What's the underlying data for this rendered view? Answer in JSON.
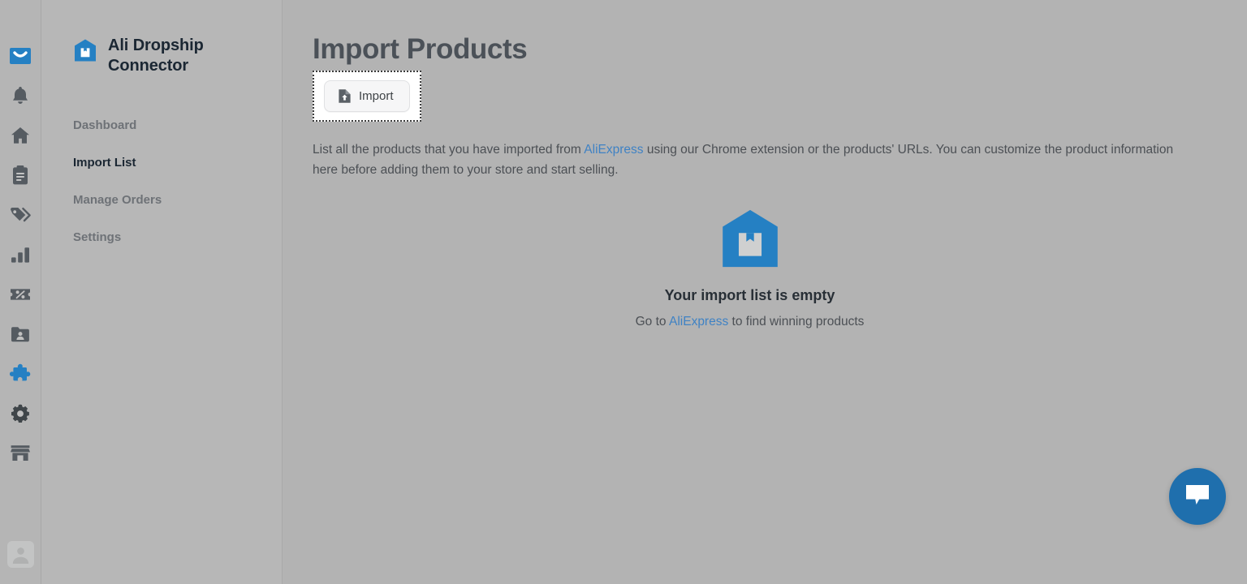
{
  "rail": {
    "items": [
      {
        "name": "mail-icon",
        "label": "Mail",
        "active": true
      },
      {
        "name": "bell-icon",
        "label": "Notifications",
        "active": false
      },
      {
        "name": "home-icon",
        "label": "Home",
        "active": false
      },
      {
        "name": "clipboard-icon",
        "label": "Orders",
        "active": false
      },
      {
        "name": "tag-icon",
        "label": "Products",
        "active": false
      },
      {
        "name": "bar-chart-icon",
        "label": "Analytics",
        "active": false
      },
      {
        "name": "discount-icon",
        "label": "Discounts",
        "active": false
      },
      {
        "name": "customers-icon",
        "label": "Customers",
        "active": false
      },
      {
        "name": "puzzle-icon",
        "label": "Apps",
        "active": true
      },
      {
        "name": "gear-icon",
        "label": "Settings",
        "active": false
      },
      {
        "name": "store-icon",
        "label": "Online Store",
        "active": false
      }
    ],
    "avatar_label": "Account"
  },
  "sidebar": {
    "brand": {
      "name": "Ali Dropship Connector",
      "line1": "Ali Dropship",
      "line2": "Connector"
    },
    "items": [
      {
        "label": "Dashboard",
        "active": false
      },
      {
        "label": "Import List",
        "active": true
      },
      {
        "label": "Manage Orders",
        "active": false
      },
      {
        "label": "Settings",
        "active": false
      }
    ]
  },
  "main": {
    "title": "Import Products",
    "import_button": {
      "label": "Import",
      "icon": "file-upload-icon"
    },
    "description": {
      "part1": "List all the products that you have imported from ",
      "link": "AliExpress",
      "part2": " using our Chrome extension or the products' URLs. You can customize the product information here before adding them to your store and start selling."
    },
    "empty_state": {
      "icon": "package-house-icon",
      "title": "Your import list is empty",
      "prefix": "Go to ",
      "link": "AliExpress",
      "suffix": " to find winning products"
    }
  },
  "chat": {
    "label": "Chat",
    "icon": "chat-bubble-icon"
  },
  "colors": {
    "brand_blue": "#2580c3",
    "chat_blue": "#1f6fad",
    "link_blue": "#3f82c4",
    "page_bg": "#b3b3b3",
    "sidebar_bg": "#b7b7b7",
    "rail_bg": "#b5b5b5",
    "icon_gray": "#555b61",
    "title_gray": "#4b5158",
    "nav_inactive": "#6e7277",
    "nav_active": "#1b2733"
  }
}
